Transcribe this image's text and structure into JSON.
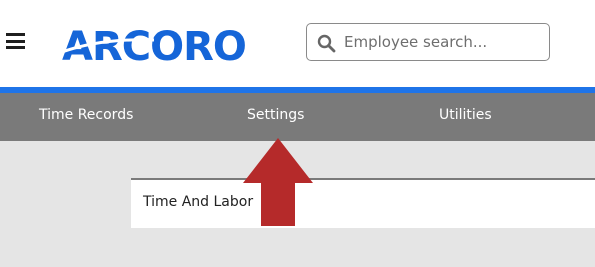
{
  "header": {
    "logo_text": "ARCORO",
    "search": {
      "placeholder": "Employee search...",
      "value": ""
    }
  },
  "nav": {
    "items": [
      {
        "label": "Time Records"
      },
      {
        "label": "Settings"
      },
      {
        "label": "Utilities"
      }
    ]
  },
  "main": {
    "panel_title": "Time And Labor"
  },
  "colors": {
    "brand": "#1565d8",
    "accent_line": "#1f74e8",
    "nav_bg": "#7a7a7a",
    "arrow": "#b52a2a"
  },
  "icons": {
    "menu": "hamburger-icon",
    "search": "search-icon",
    "annotation": "up-arrow-icon"
  }
}
